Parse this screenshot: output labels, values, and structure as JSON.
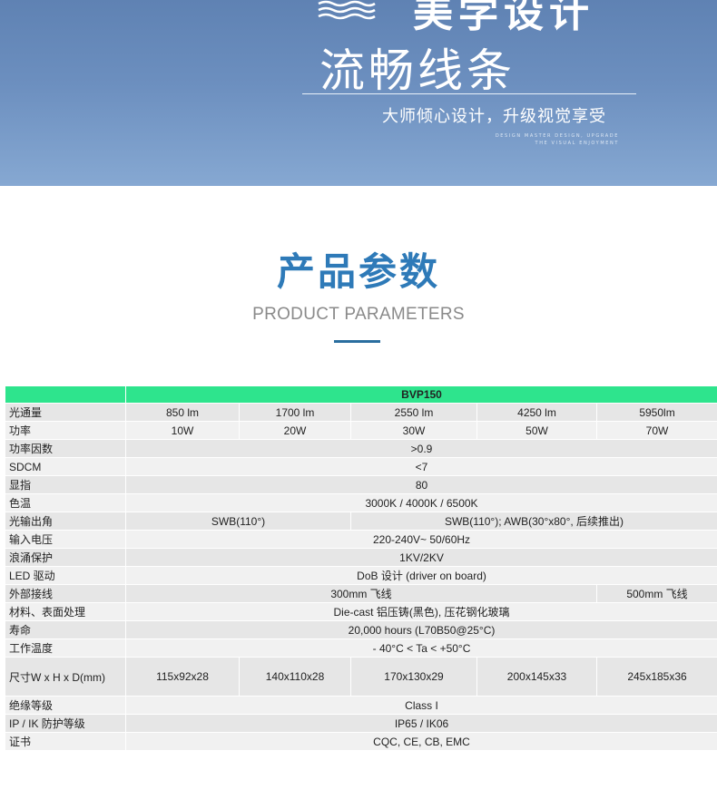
{
  "banner": {
    "heading_partial": "美学设计",
    "title": "流畅线条",
    "subtitle": "大师倾心设计，升级视觉享受",
    "english_line1": "DESIGN MASTER DESIGN, UPGRADE",
    "english_line2": "THE VISUAL ENJOYMENT"
  },
  "section": {
    "title": "产品参数",
    "subtitle": "PRODUCT PARAMETERS"
  },
  "colors": {
    "banner_top": "#5f82b3",
    "banner_bottom": "#86a8d2",
    "title_blue": "#2e7ab8",
    "header_green": "#2ee48d",
    "cell_gray": "#e6e6e6"
  },
  "table": {
    "model": "BVP150",
    "rows": {
      "flux": {
        "label": "光通量",
        "values": [
          "850 lm",
          "1700 lm",
          "2550 lm",
          "4250 lm",
          "5950lm"
        ]
      },
      "power": {
        "label": "功率",
        "values": [
          "10W",
          "20W",
          "30W",
          "50W",
          "70W"
        ]
      },
      "pf": {
        "label": "功率因数",
        "value": ">0.9"
      },
      "sdcm": {
        "label": "SDCM",
        "value": "<7"
      },
      "cri": {
        "label": "显指",
        "value": "80"
      },
      "cct": {
        "label": "色温",
        "value": "3000K / 4000K / 6500K"
      },
      "beam": {
        "label": "光输出角",
        "value_a": "SWB(110°)",
        "value_b": "SWB(110°);  AWB(30°x80°,   后续推出)"
      },
      "voltage": {
        "label": "输入电压",
        "value": "220-240V~ 50/60Hz"
      },
      "surge": {
        "label": "浪涌保护",
        "value": "1KV/2KV"
      },
      "driver": {
        "label": "LED 驱动",
        "value": "DoB 设计 (driver on board)"
      },
      "wiring": {
        "label": "外部接线",
        "value_a": "300mm 飞线",
        "value_b": "500mm 飞线"
      },
      "material": {
        "label": "材料、表面处理",
        "value": "Die-cast 铝压铸(黑色), 压花钢化玻璃"
      },
      "lifetime": {
        "label": "寿命",
        "value": "20,000 hours (L70B50@25°C)"
      },
      "temp": {
        "label": "工作温度",
        "value": "- 40°C < Ta < +50°C"
      },
      "size": {
        "label": "尺寸W x H x D(mm)",
        "values": [
          "115x92x28",
          "140x110x28",
          "170x130x29",
          "200x145x33",
          "245x185x36"
        ]
      },
      "insulation": {
        "label": "绝缘等级",
        "value": "Class I"
      },
      "ip": {
        "label": "IP / IK 防护等级",
        "value": "IP65 / IK06"
      },
      "cert": {
        "label": "证书",
        "value": "CQC, CE, CB, EMC"
      }
    }
  }
}
